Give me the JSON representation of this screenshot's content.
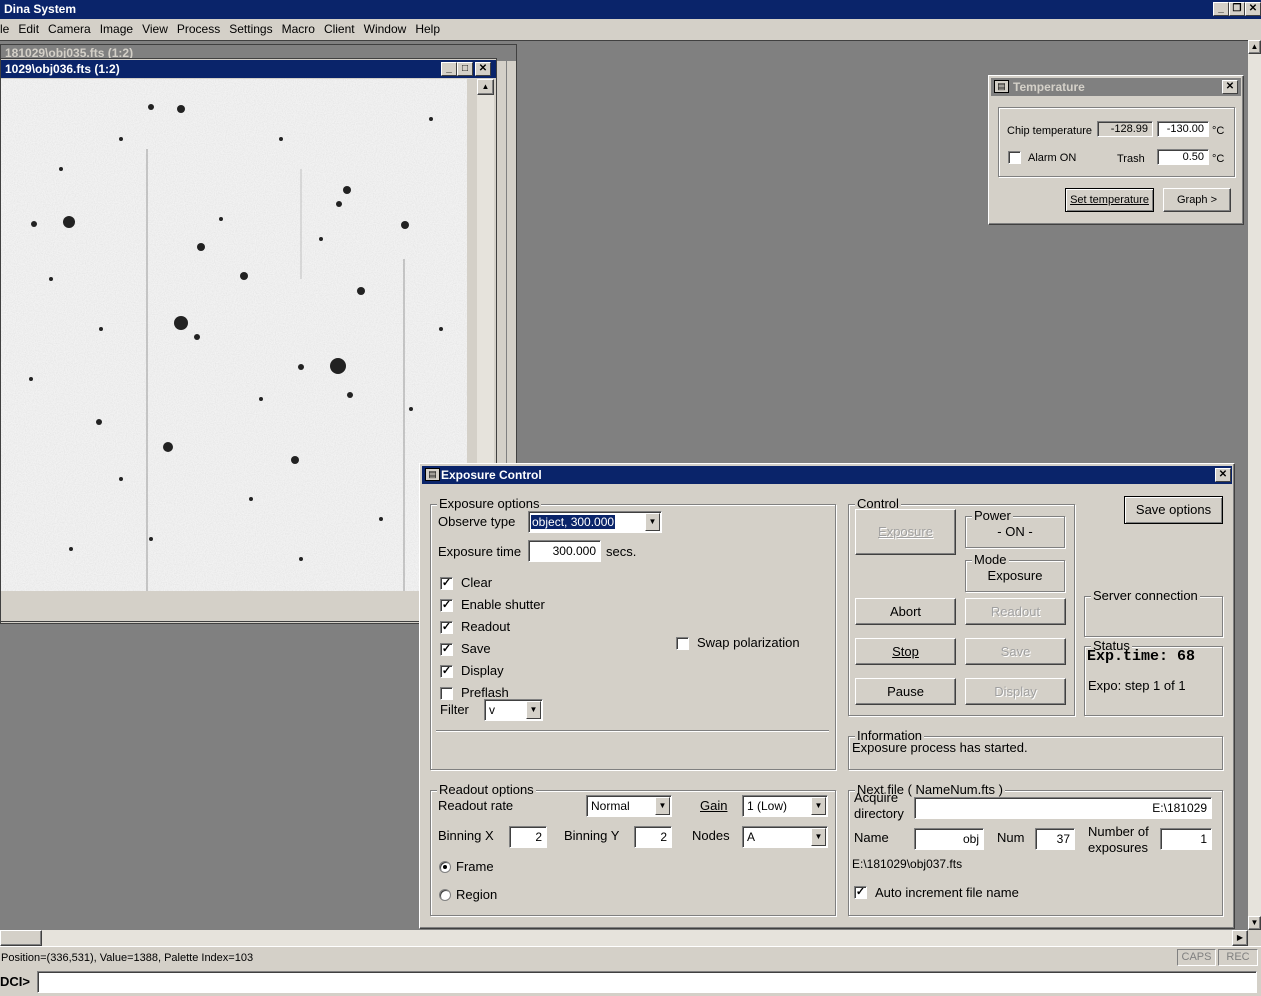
{
  "app": {
    "title": "Dina System"
  },
  "menu": [
    "le",
    "Edit",
    "Camera",
    "Image",
    "View",
    "Process",
    "Settings",
    "Macro",
    "Client",
    "Window",
    "Help"
  ],
  "image_windows": {
    "back_title": "181029\\obj035.fts (1:2)",
    "front_title": "1029\\obj036.fts (1:2)"
  },
  "temperature": {
    "title": "Temperature",
    "chip_label": "Chip temperature",
    "chip_value": "-128.99",
    "chip_setpoint": "-130.00",
    "unit": "°C",
    "alarm_label": "Alarm ON",
    "trash_label": "Trash",
    "trash_value": "0.50",
    "set_button": "Set temperature",
    "graph_button": "Graph >"
  },
  "exposure": {
    "title": "Exposure Control",
    "options_group": "Exposure options",
    "observe_label": "Observe type",
    "observe_value": "object, 300.000",
    "exptime_label": "Exposure time",
    "exptime_value": "300.000",
    "exptime_unit": "secs.",
    "checks": [
      {
        "label": "Clear",
        "checked": true
      },
      {
        "label": "Enable shutter",
        "checked": true
      },
      {
        "label": "Readout",
        "checked": true
      },
      {
        "label": "Save",
        "checked": true
      },
      {
        "label": "Display",
        "checked": true
      },
      {
        "label": "Preflash",
        "checked": false
      }
    ],
    "swap_label": "Swap polarization",
    "filter_label": "Filter",
    "filter_value": "v",
    "control_group": "Control",
    "exposure_button": "Exposure",
    "power_group": "Power",
    "power_value": "- ON -",
    "mode_group": "Mode",
    "mode_value": "Exposure",
    "abort_button": "Abort",
    "readout_button": "Readout",
    "stop_button": "Stop",
    "save_button": "Save",
    "pause_button": "Pause",
    "display_button": "Display",
    "save_options_button": "Save options",
    "server_group": "Server connection",
    "status_group": "Status",
    "status_exptime": "Exp.time:  68",
    "status_step": "Expo: step 1 of 1",
    "info_group": "Information",
    "info_text": "Exposure process has started.",
    "readout_group": "Readout options",
    "rate_label": "Readout rate",
    "rate_value": "Normal",
    "gain_label": "Gain",
    "gain_value": "1 (Low)",
    "binx_label": "Binning X",
    "binx_value": "2",
    "biny_label": "Binning Y",
    "biny_value": "2",
    "nodes_label": "Nodes",
    "nodes_value": "A",
    "frame_label": "Frame",
    "region_label": "Region",
    "nextfile_group": "Next file ( NameNum.fts )",
    "acquire_label_1": "Acquire",
    "acquire_label_2": "directory",
    "acquire_value": "E:\\181029",
    "name_label": "Name",
    "name_value": "obj",
    "num_label": "Num",
    "num_value": "37",
    "numexp_label_1": "Number of",
    "numexp_label_2": "exposures",
    "numexp_value": "1",
    "next_path": "E:\\181029\\obj037.fts",
    "auto_inc_label": "Auto increment file name"
  },
  "statusbar": {
    "text": "Position=(336,531), Value=1388, Palette Index=103",
    "caps": "CAPS",
    "rec": "REC"
  },
  "command": {
    "prompt": "DCI>",
    "value": ""
  }
}
